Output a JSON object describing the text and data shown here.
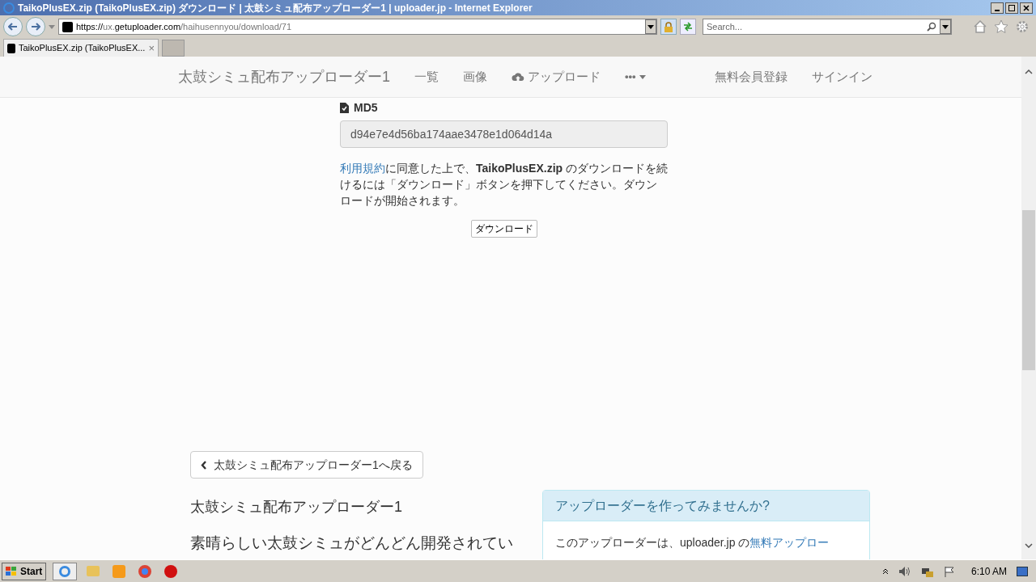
{
  "window": {
    "title": "TaikoPlusEX.zip (TaikoPlusEX.zip) ダウンロード | 太鼓シミュ配布アップローダー1 | uploader.jp - Internet Explorer"
  },
  "address_bar": {
    "scheme": "https://",
    "host_prefix": "ux.",
    "host": "getuploader.com",
    "path": "/haihusennyou/download/71"
  },
  "search": {
    "placeholder": "Search..."
  },
  "tabs": [
    {
      "label": "TaikoPlusEX.zip (TaikoPlusEX...",
      "selected": true,
      "close": "×"
    }
  ],
  "navbar": {
    "brand": "太鼓シミュ配布アップローダー1",
    "items": [
      "一覧",
      "画像",
      "アップロード"
    ],
    "more": "•••",
    "right_items": [
      "無料会員登録",
      "サインイン"
    ]
  },
  "md5": {
    "label": "MD5",
    "value": "d94e7e4d56ba174aae3478e1d064d14a"
  },
  "notice": {
    "link": "利用規約",
    "text": "に同意した上で、**TaikoPlusEX.zip** のダウンロードを続けるには「ダウンロード」ボタンを押下してください。ダウンロードが開始されます。"
  },
  "download_button": "ダウンロード",
  "back_button": "太鼓シミュ配布アップローダー1へ戻る",
  "about": {
    "title": "太鼓シミュ配布アップローダー1",
    "text": "素晴らしい太鼓シミュがどんどん開発されてい"
  },
  "promo": {
    "title": "アップローダーを作ってみませんか?",
    "text": "このアップローダーは、uploader.jp の",
    "link": "無料アップロー"
  },
  "taskbar": {
    "start": "Start",
    "clock": "6:10 AM"
  }
}
